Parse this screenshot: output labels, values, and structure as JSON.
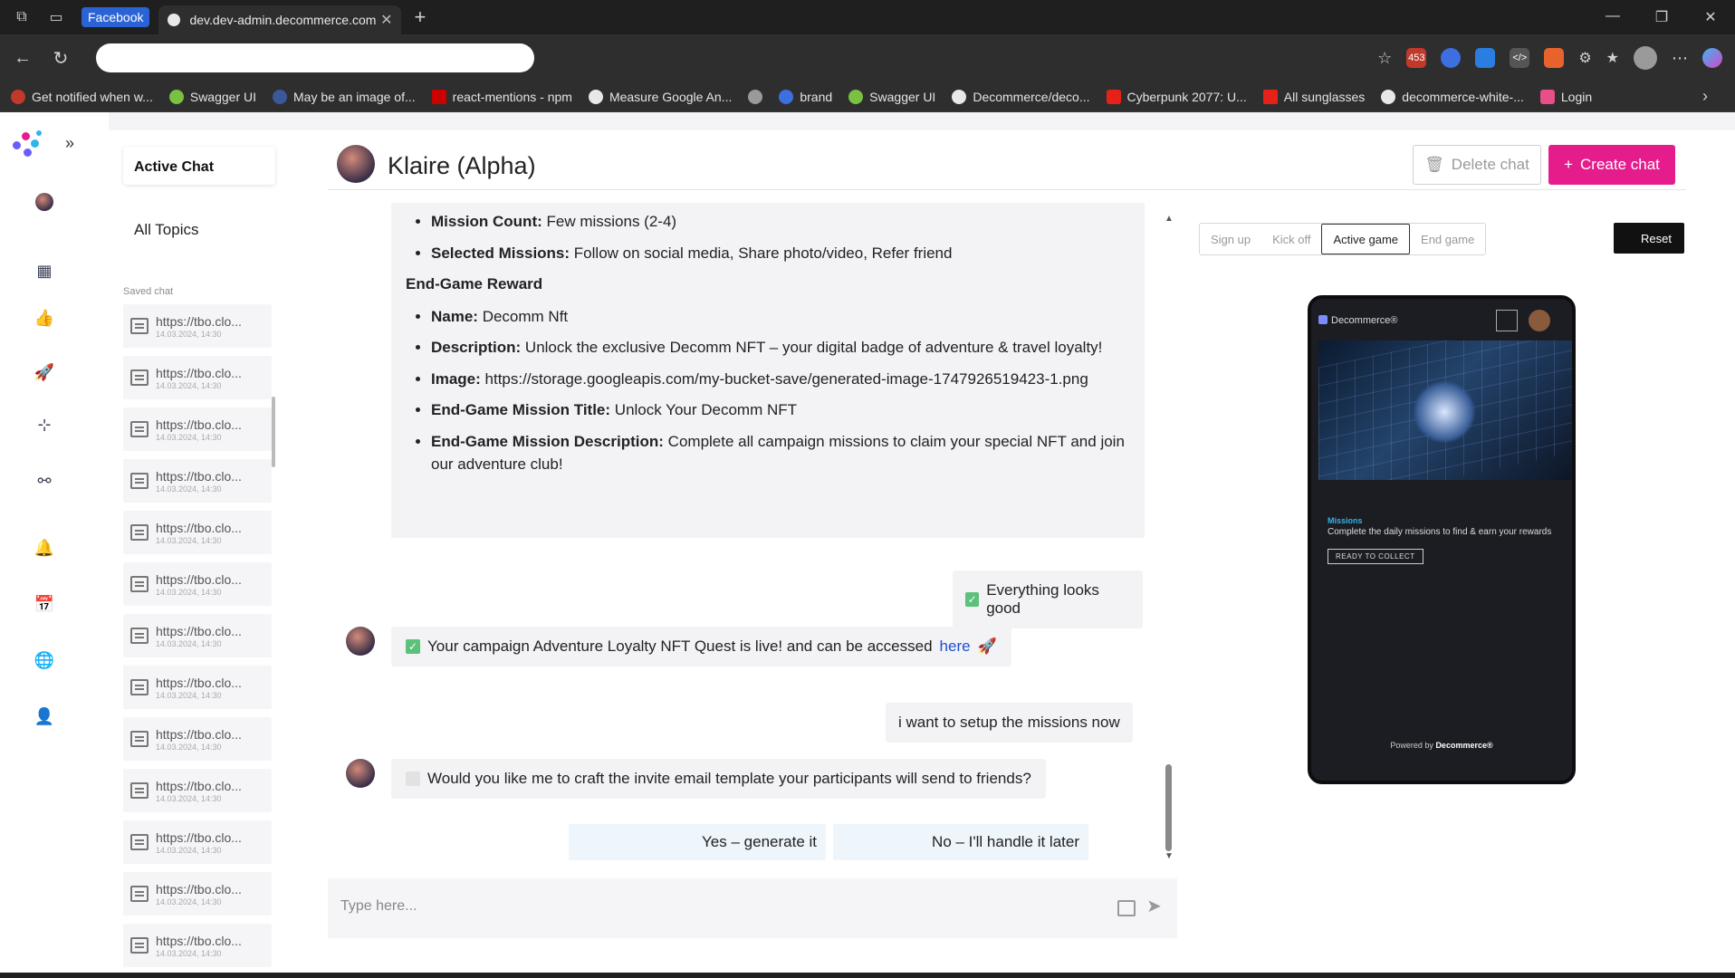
{
  "browser": {
    "facebook_badge": "Facebook",
    "tab_title": "dev.dev-admin.decommerce.com",
    "ext_badge": "453",
    "bookmarks": [
      {
        "label": "Get notified when w...",
        "color": "#c0392b"
      },
      {
        "label": "Swagger UI",
        "color": "#7ac142"
      },
      {
        "label": "May be an image of...",
        "color": "#3b5998"
      },
      {
        "label": "react-mentions - npm",
        "color": "#cb0000"
      },
      {
        "label": "Measure Google An...",
        "color": "#e8e8e8"
      },
      {
        "label": "",
        "color": "#9a9a9a"
      },
      {
        "label": "brand",
        "color": "#3d6fe0"
      },
      {
        "label": "Swagger UI",
        "color": "#7ac142"
      },
      {
        "label": "Decommerce/deco...",
        "color": "#e8e8e8"
      },
      {
        "label": "Cyberpunk 2077: U...",
        "color": "#e62117"
      },
      {
        "label": "All sunglasses",
        "color": "#e62117"
      },
      {
        "label": "decommerce-white-...",
        "color": "#e8e8e8"
      },
      {
        "label": "Login",
        "color": "#e84e8a"
      }
    ]
  },
  "sidebar": {
    "active_menu": "Active Chat",
    "menu_item": "All Topics",
    "saved_label": "Saved chat",
    "saved_items": [
      {
        "title": "https://tbo.clo...",
        "date": "14.03.2024, 14:30"
      },
      {
        "title": "https://tbo.clo...",
        "date": "14.03.2024, 14:30"
      },
      {
        "title": "https://tbo.clo...",
        "date": "14.03.2024, 14:30"
      },
      {
        "title": "https://tbo.clo...",
        "date": "14.03.2024, 14:30"
      },
      {
        "title": "https://tbo.clo...",
        "date": "14.03.2024, 14:30"
      },
      {
        "title": "https://tbo.clo...",
        "date": "14.03.2024, 14:30"
      },
      {
        "title": "https://tbo.clo...",
        "date": "14.03.2024, 14:30"
      },
      {
        "title": "https://tbo.clo...",
        "date": "14.03.2024, 14:30"
      },
      {
        "title": "https://tbo.clo...",
        "date": "14.03.2024, 14:30"
      },
      {
        "title": "https://tbo.clo...",
        "date": "14.03.2024, 14:30"
      },
      {
        "title": "https://tbo.clo...",
        "date": "14.03.2024, 14:30"
      },
      {
        "title": "https://tbo.clo...",
        "date": "14.03.2024, 14:30"
      },
      {
        "title": "https://tbo.clo...",
        "date": "14.03.2024, 14:30"
      }
    ]
  },
  "header": {
    "bot_name": "Klaire (Alpha)",
    "delete_label": "Delete chat",
    "create_label": "Create chat"
  },
  "chat": {
    "summary": {
      "mission_count_label": "Mission Count:",
      "mission_count_value": "Few missions (2-4)",
      "selected_missions_label": "Selected Missions:",
      "selected_missions_value": "Follow on social media, Share photo/video, Refer friend",
      "reward_title": "End-Game Reward",
      "name_label": "Name:",
      "name_value": "Decomm Nft",
      "description_label": "Description:",
      "description_value": "Unlock the exclusive Decomm NFT – your digital badge of adventure & travel loyalty!",
      "image_label": "Image:",
      "image_value": "https://storage.googleapis.com/my-bucket-save/generated-image-1747926519423-1.png",
      "mission_title_label": "End-Game Mission Title:",
      "mission_title_value": "Unlock Your Decomm NFT",
      "mission_desc_label": "End-Game Mission Description:",
      "mission_desc_value": "Complete all campaign missions to claim your special NFT and join our adventure club!"
    },
    "user_msg_1": "Everything looks good",
    "bot_msg_1_text": "Your campaign Adventure Loyalty NFT Quest is live! and can be accessed",
    "bot_msg_1_link": "here",
    "bot_msg_1_emoji": "🚀",
    "user_msg_2": "i want to setup the missions now",
    "bot_msg_2": "Would you like me to craft the invite email template your participants will send to friends?",
    "quick_reply_yes": "Yes – generate it",
    "quick_reply_no": "No – I'll handle it later",
    "input_placeholder": "Type here..."
  },
  "preview": {
    "tabs": [
      "Sign up",
      "Kick off",
      "Active game",
      "End game"
    ],
    "active_tab": "Active game",
    "reset_label": "Reset",
    "phone": {
      "brand": "Decommerce®",
      "missions_title": "Missions",
      "missions_sub": "Complete the daily missions to find & earn your rewards",
      "collect_label": "READY TO COLLECT",
      "powered_by": "Powered by",
      "powered_brand": "Decommerce®"
    }
  }
}
